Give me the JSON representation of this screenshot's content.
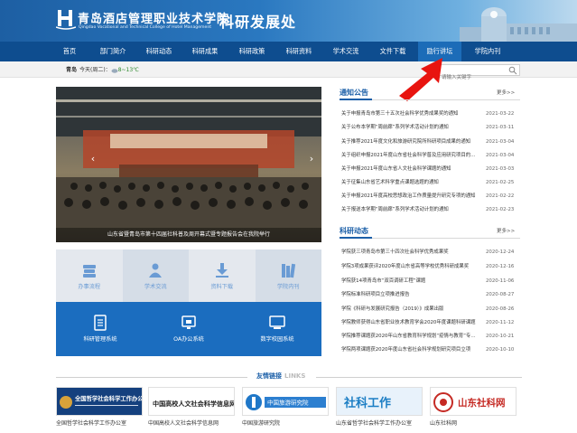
{
  "header": {
    "school_cn": "青岛酒店管理职业技术学院",
    "school_en": "Qingdao Vocational and Technical College of Hotel Management",
    "dept_title": "科研发展处"
  },
  "nav": {
    "items": [
      {
        "label": "首页"
      },
      {
        "label": "部门简介"
      },
      {
        "label": "科研动态"
      },
      {
        "label": "科研成果"
      },
      {
        "label": "科研政策"
      },
      {
        "label": "科研资料"
      },
      {
        "label": "学术交流"
      },
      {
        "label": "文件下载"
      },
      {
        "label": "励行讲坛"
      },
      {
        "label": "学院内刊"
      }
    ],
    "active_index": 8
  },
  "infobar": {
    "city": "青岛",
    "weather_prefix": "今天(周二)：",
    "weather_temp": "8~13℃",
    "weather_icon": "cloud-icon",
    "search_placeholder": "请输入关键字"
  },
  "annotation": {
    "color": "#e8140f",
    "shape": "red-arrow"
  },
  "slider": {
    "caption": "山东省暨青岛市第十四届社科普及周开幕式暨专题报告会在我院举行",
    "prev_glyph": "‹",
    "next_glyph": "›"
  },
  "quick_links": {
    "top": [
      {
        "label": "办事流程",
        "icon": "book-stack-icon"
      },
      {
        "label": "学术交流",
        "icon": "people-icon"
      },
      {
        "label": "资料下载",
        "icon": "download-icon"
      },
      {
        "label": "学院内刊",
        "icon": "books-icon"
      }
    ],
    "bottom": [
      {
        "label": "科研管理系统",
        "icon": "document-icon"
      },
      {
        "label": "OA办公系统",
        "icon": "monitor-icon"
      },
      {
        "label": "数字校园系统",
        "icon": "display-icon"
      }
    ]
  },
  "notices": {
    "title": "通知公告",
    "more": "更多>>",
    "items": [
      {
        "title": "关于申报青岛市第三十五次社会科学优秀成果奖的通知",
        "date": "2021-03-22"
      },
      {
        "title": "关于公布本学期“周前廊”系列学术活动计划的通知",
        "date": "2021-03-11"
      },
      {
        "title": "关于推荐2021年度文化和旅游研究院所科研项目成果的通知",
        "date": "2021-03-04"
      },
      {
        "title": "关于组织申报2021年度山东省社会科学普及应用研究项目的通知",
        "date": "2021-03-04"
      },
      {
        "title": "关于申报2021年度山东省人文社会科学课题的通知",
        "date": "2021-03-03"
      },
      {
        "title": "关于征集山东省艺术科学重点课题选题的通知",
        "date": "2021-02-25"
      },
      {
        "title": "关于申报2021年度高校思想政治工作质量提升研究专项的通知",
        "date": "2021-02-22"
      },
      {
        "title": "关于报送本学期“周前廊”系列学术活动计划的通知",
        "date": "2021-02-23"
      }
    ]
  },
  "research": {
    "title": "科研动态",
    "more": "更多>>",
    "items": [
      {
        "title": "学院获三项青岛市第三十四次社会科学优秀成果奖",
        "date": "2020-12-24"
      },
      {
        "title": "学院3项成果获评2020年度山东省高等学校优秀科研成果奖",
        "date": "2020-12-16"
      },
      {
        "title": "学院获14项青岛市“双百调研工程”课题",
        "date": "2020-11-06"
      },
      {
        "title": "学院标准科研项目立项推进报告",
        "date": "2020-08-27"
      },
      {
        "title": "学院《科研与发展研究报告（2019）》成果出版",
        "date": "2020-08-26"
      },
      {
        "title": "学院教师获得山东省职业技术教育学会2020年度课题科研课题",
        "date": "2020-11-12"
      },
      {
        "title": "学院推荐课题获2020年山东省教育科学规划“疫情与教育”专项课题",
        "date": "2020-10-21"
      },
      {
        "title": "学院两项课题获2020年度山东省社会科学规划研究项目立项",
        "date": "2020-10-10"
      }
    ]
  },
  "friends": {
    "title": "友情链接",
    "title_en": "LINKS",
    "items": [
      {
        "logo_text": "全国哲学社会科学工作办公室",
        "name": "全国哲学社会科学工作办公室"
      },
      {
        "logo_text": "中国高校人文社会科学信息网",
        "name": "中国高校人文社会科学信息网"
      },
      {
        "logo_text": "中国旅游研究院",
        "name": "中国旅游研究院"
      },
      {
        "logo_text": "社科工作",
        "name": "山东省哲学社会科学工作办公室"
      },
      {
        "logo_text": "山东社科网",
        "name": "山东社科网"
      }
    ]
  }
}
